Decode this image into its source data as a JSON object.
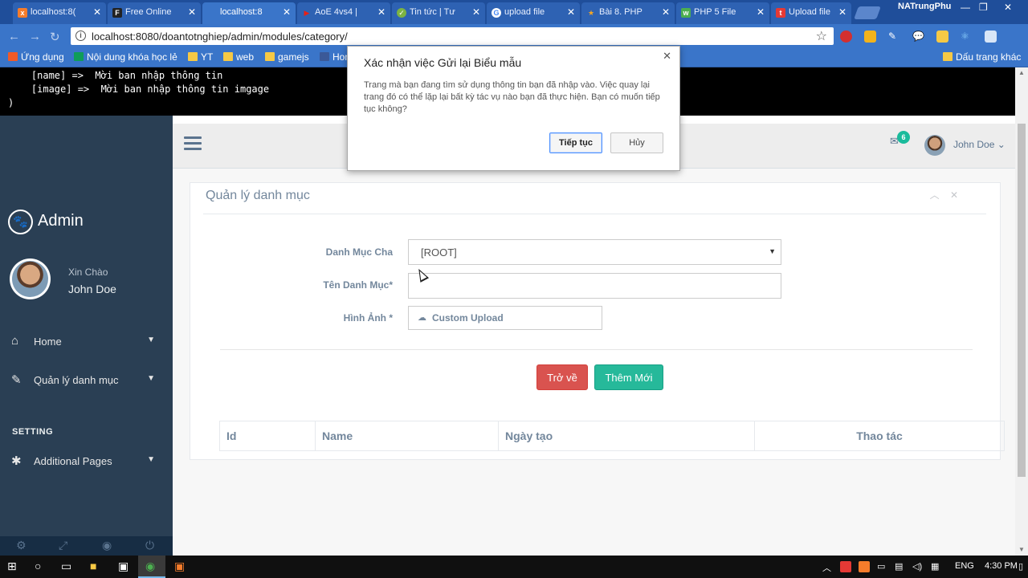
{
  "browser": {
    "tabs": [
      {
        "label": "localhost:8(",
        "favicon": "xampp-icon",
        "color": "#f57c2b"
      },
      {
        "label": "Free Online",
        "favicon": "freeonline-icon",
        "color": "#222222"
      },
      {
        "label": "localhost:8",
        "favicon": "page-icon",
        "color": "#888888"
      },
      {
        "label": "AoE 4vs4 |",
        "favicon": "youtube-icon",
        "color": "#e62117"
      },
      {
        "label": "Tin tức | Tư",
        "favicon": "news-icon",
        "color": "#7cb342"
      },
      {
        "label": "upload file",
        "favicon": "google-icon",
        "color": "#4285f4"
      },
      {
        "label": "Bài 8. PHP",
        "favicon": "star-icon",
        "color": "#f5a623"
      },
      {
        "label": "PHP 5 File",
        "favicon": "w3schools-icon",
        "color": "#4caf50"
      },
      {
        "label": "Upload file",
        "favicon": "stackoverflow-icon",
        "color": "#e53935"
      }
    ],
    "profile_name": "NATrungPhu",
    "url": "localhost:8080/doantotnghiep/admin/modules/category/",
    "bookmarks": [
      {
        "label": "Ứng dụng"
      },
      {
        "label": "Nội dung khóa học lẻ"
      },
      {
        "label": "YT"
      },
      {
        "label": "web"
      },
      {
        "label": "gamejs"
      },
      {
        "label": "Hon"
      }
    ],
    "bookmarks_other": "Dấu trang khác"
  },
  "debug_output": "    [name] =>  Mời ban nhập thông tin\n    [image] =>  Mời ban nhập thông tin imgage\n)",
  "sidebar": {
    "brand": "Admin",
    "welcome": "Xin Chào",
    "user": "John Doe",
    "menu": [
      {
        "label": "Home"
      },
      {
        "label": "Quản lý danh mục"
      }
    ],
    "section": "SETTING",
    "extra_menu": [
      {
        "label": "Additional Pages"
      }
    ]
  },
  "topnav": {
    "mail_count": "6",
    "user": "John Doe"
  },
  "panel": {
    "title": "Quản lý danh mục",
    "form": {
      "parent_label": "Danh Mục Cha",
      "parent_value": "[ROOT]",
      "name_label": "Tên Danh Mục*",
      "name_value": "",
      "image_label": "Hình Ảnh *",
      "upload_label": "Custom Upload"
    },
    "buttons": {
      "back": "Trở về",
      "add": "Thêm Mới"
    },
    "table_headers": [
      "Id",
      "Name",
      "Ngày tạo",
      "Thao tác"
    ]
  },
  "dialog": {
    "title": "Xác nhận việc Gửi lại Biểu mẫu",
    "message": "Trang mà bạn đang tìm sử dụng thông tin bạn đã nhập vào. Việc quay lại trang đó có thể lặp lại bất kỳ tác vụ nào bạn đã thực hiện. Bạn có muốn tiếp tục không?",
    "confirm": "Tiếp tục",
    "cancel": "Hủy"
  },
  "taskbar": {
    "language": "ENG",
    "time": "4:30 PM"
  }
}
